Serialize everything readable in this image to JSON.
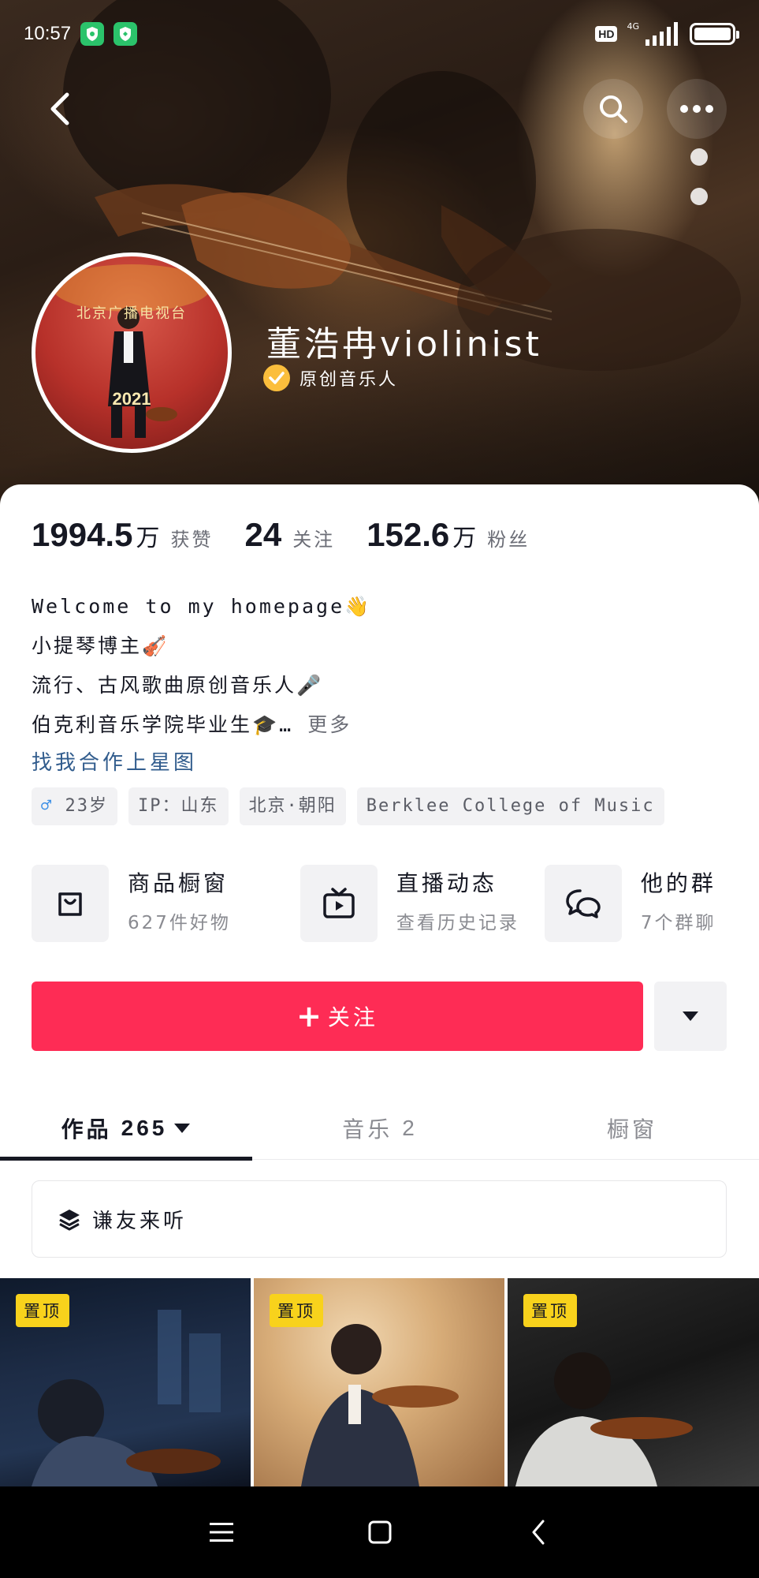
{
  "status_bar": {
    "time": "10:57",
    "hd": "HD",
    "network": "4G",
    "icons": [
      "shield-app-icon",
      "shield-app-icon",
      "signal-icon",
      "battery-icon"
    ]
  },
  "profile": {
    "name": "董浩冉violinist",
    "verified_label": "原创音乐人",
    "avatar_text_top": "北京广播电视台",
    "avatar_text_bottom": "2021",
    "accent_color": "#fe2c55",
    "verified_color": "#fbbe3c"
  },
  "stats": [
    {
      "value": "1994.5",
      "unit": "万",
      "label": "获赞"
    },
    {
      "value": "24",
      "unit": "",
      "label": "关注"
    },
    {
      "value": "152.6",
      "unit": "万",
      "label": "粉丝"
    }
  ],
  "bio": {
    "line1": "Welcome to my homepage",
    "line1_emoji": "👋",
    "line2": "小提琴博主",
    "line2_emoji": "🎻",
    "line3": "流行、古风歌曲原创音乐人",
    "line3_emoji": "🎤",
    "line4": "伯克利音乐学院毕业生",
    "line4_emoji": "🎓",
    "line4_suffix": "…",
    "more": "更多",
    "link": "找我合作上星图"
  },
  "tags": {
    "gender_symbol": "♂",
    "age": "23岁",
    "ip": "IP：山东",
    "location": "北京·朝阳",
    "school": "Berklee College of Music"
  },
  "services": [
    {
      "title": "商品橱窗",
      "subtitle": "627件好物",
      "icon": "shopping-bag-icon"
    },
    {
      "title": "直播动态",
      "subtitle": "查看历史记录",
      "icon": "tv-play-icon"
    },
    {
      "title": "他的群",
      "subtitle": "7个群聊",
      "icon": "chat-bubbles-icon"
    }
  ],
  "follow": {
    "label": "关注",
    "plus": "+"
  },
  "tabs": [
    {
      "label": "作品",
      "count": "265"
    },
    {
      "label": "音乐",
      "count": "2"
    },
    {
      "label": "橱窗",
      "count": ""
    }
  ],
  "collection": {
    "label": "谦友来听"
  },
  "videos": [
    {
      "pin": "置顶"
    },
    {
      "pin": "置顶"
    },
    {
      "pin": "置顶"
    }
  ]
}
